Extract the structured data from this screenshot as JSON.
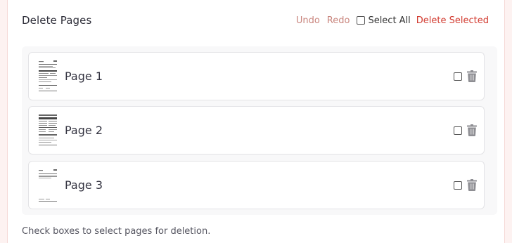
{
  "header": {
    "title": "Delete Pages",
    "undo_label": "Undo",
    "redo_label": "Redo",
    "select_all_label": "Select All",
    "delete_selected_label": "Delete Selected"
  },
  "pages": [
    {
      "label": "Page 1",
      "checked": false
    },
    {
      "label": "Page 2",
      "checked": false
    },
    {
      "label": "Page 3",
      "checked": false
    }
  ],
  "hint": "Check boxes to select pages for deletion.",
  "colors": {
    "accent_muted": "#c9857d",
    "danger": "#d23a2f",
    "trash": "#8e8e93"
  }
}
